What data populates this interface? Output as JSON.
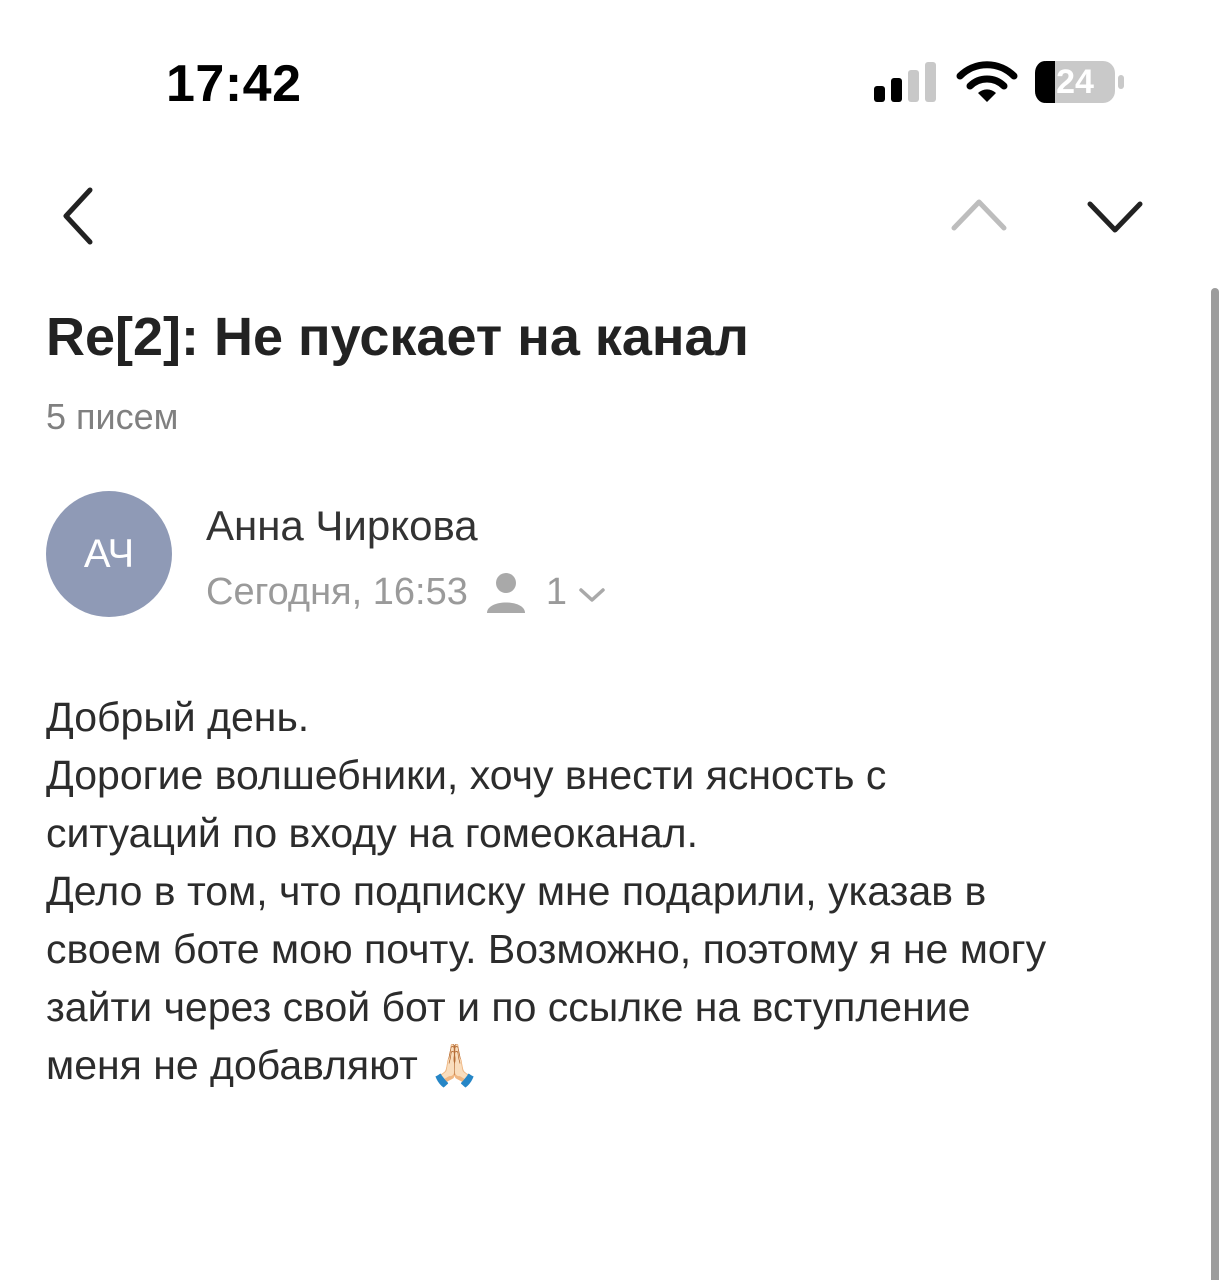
{
  "status_bar": {
    "time": "17:42",
    "battery": "24",
    "icons": [
      "signal-icon",
      "wifi-icon",
      "battery-icon"
    ]
  },
  "nav": {
    "back_icon": "chevron-left-icon",
    "prev_icon": "chevron-up-icon",
    "next_icon": "chevron-down-icon"
  },
  "thread": {
    "subject": "Re[2]: Не пускает на канал",
    "message_count": "5 писем"
  },
  "message": {
    "sender_initials": "АЧ",
    "sender_name": "Анна Чиркова",
    "date": "Сегодня, 16:53",
    "recipient_count": "1",
    "body": [
      "Добрый день.",
      "Дорогие волшебники, хочу внести ясность с",
      "ситуаций по входу на гомеоканал.",
      "Дело в том, что подписку мне подарили, указав в",
      "своем боте мою почту. Возможно, поэтому я не могу",
      "зайти через свой бот и по ссылке на вступление",
      "меня не добавляют 🙏🏻"
    ]
  },
  "colors": {
    "avatar": "#8f9ab6",
    "secondary_text": "#9a9a9a",
    "title_text": "#222222"
  }
}
